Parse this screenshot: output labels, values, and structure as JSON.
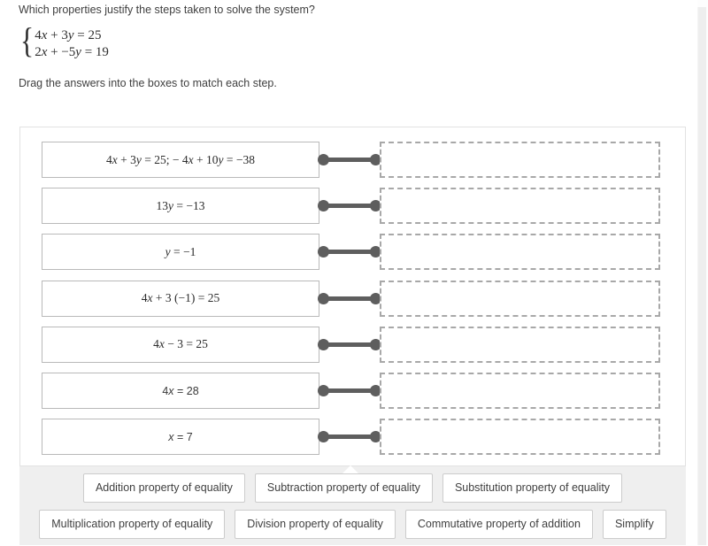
{
  "question": {
    "title": "Which properties justify the steps taken to solve the system?",
    "system": {
      "brace": "{",
      "equation_1": "4x + 3y = 25",
      "equation_2": "2x + −5y = 19"
    },
    "instruction": "Drag the answers into the boxes to match each step."
  },
  "steps": [
    {
      "text": "4x + 3y = 25;  − 4x + 10y = −38",
      "style": "serif",
      "drop_value": ""
    },
    {
      "text": "13y = −13",
      "style": "serif",
      "drop_value": ""
    },
    {
      "text": "y = −1",
      "style": "serif",
      "drop_value": ""
    },
    {
      "text": "4x + 3 (−1) = 25",
      "style": "serif",
      "drop_value": ""
    },
    {
      "text": "4x − 3 = 25",
      "style": "serif",
      "drop_value": ""
    },
    {
      "text": "4x = 28",
      "style": "sans",
      "drop_value": ""
    },
    {
      "text": "x = 7",
      "style": "sans",
      "drop_value": ""
    }
  ],
  "answer_bank": {
    "row_1": [
      "Addition property of equality",
      "Subtraction property of equality",
      "Substitution property of equality"
    ],
    "row_2": [
      "Multiplication property of equality",
      "Division property of equality",
      "Commutative property of addition",
      "Simplify"
    ]
  },
  "colors": {
    "connector": "#5e5e5e",
    "bank_background": "#efefef",
    "drop_border": "#a8a8a8",
    "step_border": "#b9b9b9"
  }
}
